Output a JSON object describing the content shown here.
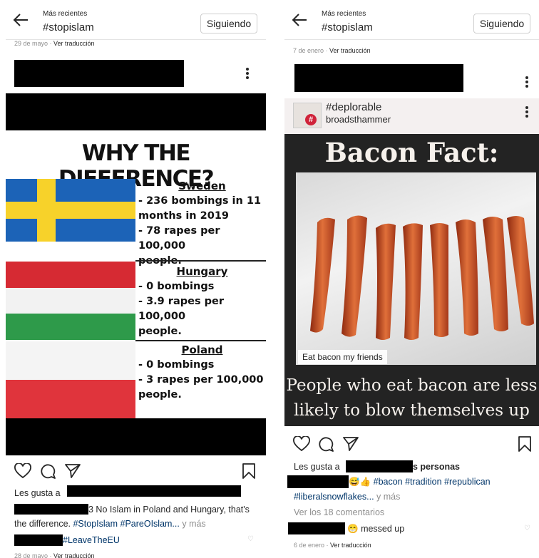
{
  "left": {
    "header": {
      "subtitle": "Más recientes",
      "title": "#stopislam",
      "follow_label": "Siguiendo"
    },
    "post_date": "29 de mayo",
    "see_translation": "Ver traducción",
    "image": {
      "headline": "WHY THE DIFFERENCE?",
      "blocks": [
        {
          "country": "Sweden",
          "lines": [
            "- 236 bombings in 11",
            "months in 2019",
            "- 78 rapes per 100,000",
            "people."
          ]
        },
        {
          "country": "Hungary",
          "lines": [
            "- 0 bombings",
            "- 3.9 rapes per 100,000",
            "people."
          ]
        },
        {
          "country": "Poland",
          "lines": [
            "- 0 bombings",
            "- 3 rapes per 100,000",
            "people."
          ]
        }
      ]
    },
    "likes_prefix": "Les gusta a",
    "caption_text": "3 No Islam in Poland and Hungary, that's",
    "caption_line2_prefix": "the difference.",
    "caption_hashtags": "#StopIslam #PareOIslam...",
    "more": "y más",
    "caption_line3_tag": "#LeaveTheEU",
    "next_date": "28 de mayo",
    "next_translation": "Ver traducción"
  },
  "right": {
    "header": {
      "subtitle": "Más recientes",
      "title": "#stopislam",
      "follow_label": "Siguiendo"
    },
    "post_date": "7 de enero",
    "see_translation": "Ver traducción",
    "embedded": {
      "title": "#deplorable",
      "account": "broadsthammer",
      "hash_badge": "#"
    },
    "image": {
      "headline": "Bacon Fact:",
      "photo_tag": "Eat bacon my friends",
      "caption_line1": "People who eat bacon are less",
      "caption_line2": "likely to blow themselves up"
    },
    "likes_prefix": "Les gusta a",
    "likes_suffix": "s personas",
    "caption_emoji": "😅👍",
    "caption_hashtags": "#bacon #tradition #republican",
    "caption_line2": "#liberalsnowflakes...",
    "more": "y más",
    "view_comments": "Ver los 18 comentarios",
    "comment_emoji": "😁",
    "comment_text": "messed up",
    "comment_date": "6 de enero",
    "comment_translation": "Ver traducción"
  },
  "icons": [
    "back-arrow-icon",
    "more-options-icon",
    "heart-icon",
    "comment-icon",
    "share-icon",
    "bookmark-icon"
  ],
  "colors": {
    "hashtag": "#003569",
    "muted": "#8e8e8e",
    "text": "#262626"
  }
}
